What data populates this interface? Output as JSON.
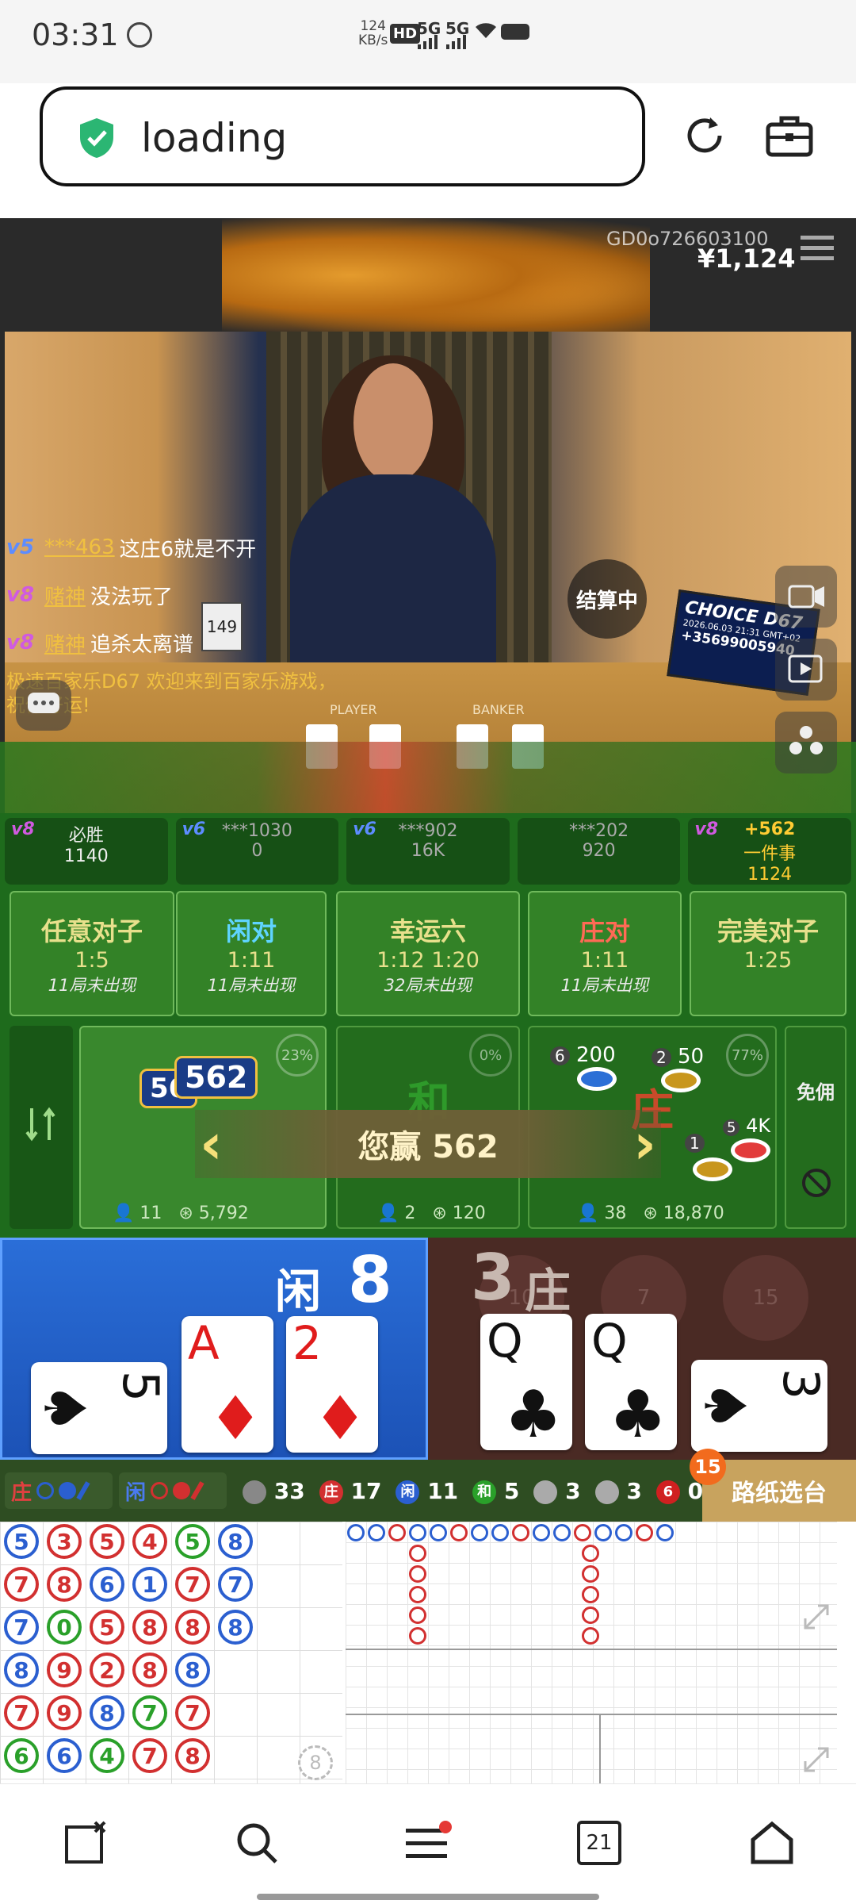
{
  "status_bar": {
    "time": "03:31",
    "net_speed_value": "124",
    "net_speed_unit": "KB/s",
    "hd_label": "HD",
    "sim1": "5G",
    "sim2": "5G"
  },
  "browser": {
    "address_text": "loading"
  },
  "video": {
    "game_id": "GD0o726603100",
    "balance": "¥1,124",
    "settling_label": "结算中",
    "monitor_brand": "CHOICE D67",
    "monitor_date": "2026.06.03 21:31 GMT+02",
    "monitor_number": "+35699005940",
    "shoe_label": "149",
    "table_labels": {
      "player": "PLAYER",
      "banker": "BANKER"
    },
    "chat": [
      {
        "level": "v5",
        "user": "***463",
        "text": "这庄6就是不开"
      },
      {
        "level": "v8",
        "user": "赌神",
        "text": "没法玩了"
      },
      {
        "level": "v8",
        "user": "赌神",
        "text": "追杀太离谱"
      }
    ],
    "welcome_text": "极速百家乐D67 欢迎来到百家乐游戏，祝你好运!"
  },
  "players_row": [
    {
      "level": "v8",
      "name": "必胜",
      "amount": "1140"
    },
    {
      "level": "v6",
      "name": "***1030",
      "amount": "0"
    },
    {
      "level": "v6",
      "name": "***902",
      "amount": "16K"
    },
    {
      "level": "",
      "name": "***202",
      "amount": "920"
    },
    {
      "level": "v8",
      "name": "一件事",
      "amount": "1124",
      "win": "+562"
    }
  ],
  "side_bets": [
    {
      "name": "任意对子",
      "odds": "1:5",
      "note": "11局未出现",
      "color": "#e8e08c"
    },
    {
      "name": "闲对",
      "odds": "1:11",
      "note": "11局未出现",
      "color": "#5fd4ff"
    },
    {
      "name": "幸运六",
      "odds": "1:12   1:20",
      "note": "32局未出现",
      "color": "#e8e08c"
    },
    {
      "name": "庄对",
      "odds": "1:11",
      "note": "11局未出现",
      "color": "#ff6a55"
    },
    {
      "name": "完美对子",
      "odds": "1:25",
      "note": "",
      "color": "#e8e08c"
    }
  ],
  "main_bets": [
    {
      "name": "闲",
      "percent": "23%",
      "players": "11",
      "total": "5,792",
      "chip": "562",
      "chip2": "56"
    },
    {
      "name": "和",
      "percent": "0%",
      "players": "2",
      "total": "120"
    },
    {
      "name": "庄",
      "percent": "77%",
      "players": "38",
      "total": "18,870",
      "chip_a": "200",
      "chip_a_count": "6",
      "chip_b": "50",
      "chip_b_count": "2",
      "chip_c": "4K",
      "chip_c_count": "5",
      "chip_d_count": "1"
    }
  ],
  "commission_label": "免佣",
  "win_banner": "您赢 562",
  "result": {
    "player_label": "闲",
    "player_score": "8",
    "banker_label": "庄",
    "banker_score": "3",
    "player_cards": [
      "5",
      "A",
      "2"
    ],
    "banker_cards": [
      "Q",
      "Q",
      "3"
    ],
    "bg_numbers": [
      "10",
      "7",
      "15"
    ]
  },
  "road_bar": {
    "banker_tag": "庄",
    "player_tag": "闲",
    "stats": [
      {
        "label": "",
        "value": "33",
        "color": "#888888"
      },
      {
        "label": "庄",
        "value": "17",
        "color": "#d23030"
      },
      {
        "label": "闲",
        "value": "11",
        "color": "#2b5fd0"
      },
      {
        "label": "和",
        "value": "5",
        "color": "#2aa02a"
      },
      {
        "label": "",
        "value": "3",
        "color": "#c03030"
      },
      {
        "label": "",
        "value": "3",
        "color": "#3060c0"
      },
      {
        "label": "6",
        "value": "0",
        "color": "#d02020"
      }
    ],
    "select_table": "路纸选台",
    "badge": "15"
  },
  "bead_road": [
    [
      "5",
      "3",
      "5",
      "4",
      "5",
      "8"
    ],
    [
      "7",
      "8",
      "6",
      "1",
      "7",
      "7"
    ],
    [
      "7",
      "0",
      "5",
      "8",
      "8",
      "8"
    ],
    [
      "8",
      "9",
      "2",
      "8",
      "8"
    ],
    [
      "7",
      "9",
      "8",
      "7",
      "7"
    ],
    [
      "6",
      "6",
      "4",
      "7",
      "8"
    ]
  ],
  "bead_colors": [
    [
      "b",
      "r",
      "r",
      "r",
      "g",
      "b"
    ],
    [
      "r",
      "r",
      "b",
      "b",
      "r",
      "b"
    ],
    [
      "b",
      "g",
      "r",
      "r",
      "r",
      "b"
    ],
    [
      "b",
      "r",
      "r",
      "r",
      "b"
    ],
    [
      "r",
      "r",
      "b",
      "g",
      "r"
    ],
    [
      "g",
      "b",
      "g",
      "r",
      "r"
    ]
  ],
  "shoe_counter": "8",
  "bottom_nav": {
    "tabs_count": "21"
  }
}
